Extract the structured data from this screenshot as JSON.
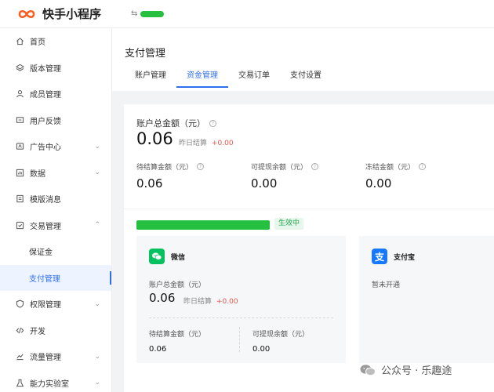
{
  "app": {
    "title": "快手小程序",
    "account_switch_icon": "⇆"
  },
  "sidebar": {
    "items": [
      {
        "label": "首页",
        "icon": "home-icon",
        "chevron": ""
      },
      {
        "label": "版本管理",
        "icon": "layers-icon",
        "chevron": ""
      },
      {
        "label": "成员管理",
        "icon": "user-icon",
        "chevron": ""
      },
      {
        "label": "用户反馈",
        "icon": "message-icon",
        "chevron": ""
      },
      {
        "label": "广告中心",
        "icon": "ad-icon",
        "chevron": "⌄"
      },
      {
        "label": "数据",
        "icon": "chart-icon",
        "chevron": "⌄"
      },
      {
        "label": "模版消息",
        "icon": "template-icon",
        "chevron": ""
      },
      {
        "label": "交易管理",
        "icon": "trade-icon",
        "chevron": "⌃"
      },
      {
        "label": "保证金",
        "sub": true
      },
      {
        "label": "支付管理",
        "sub": true,
        "active": true
      },
      {
        "label": "权限管理",
        "icon": "shield-icon",
        "chevron": "⌄"
      },
      {
        "label": "开发",
        "icon": "code-icon",
        "chevron": ""
      },
      {
        "label": "流量管理",
        "icon": "traffic-icon",
        "chevron": "⌄"
      },
      {
        "label": "能力实验室",
        "icon": "lab-icon",
        "chevron": "⌄"
      }
    ]
  },
  "page": {
    "title": "支付管理",
    "tabs": [
      "账户管理",
      "资金管理",
      "交易订单",
      "支付设置"
    ],
    "active_tab": 1
  },
  "summary": {
    "total_label": "账户总金额（元）",
    "total_amount": "0.06",
    "yesterday_label": "昨日结算",
    "yesterday_value": "+0.00",
    "pending_label": "待结算金额（元）",
    "pending_value": "0.06",
    "withdrawable_label": "可提现余额（元）",
    "withdrawable_value": "0.00",
    "frozen_label": "冻结金额（元）",
    "frozen_value": "0.00"
  },
  "account_status": "生效中",
  "wechat": {
    "name": "微信",
    "total_label": "账户总金额（元）",
    "total_amount": "0.06",
    "yesterday_label": "昨日结算",
    "yesterday_value": "+0.00",
    "pending_label": "待结算金额（元）",
    "pending_value": "0.06",
    "withdrawable_label": "可提现余额（元）",
    "withdrawable_value": "0.00"
  },
  "alipay": {
    "name": "支付宝",
    "status": "暂未开通"
  },
  "watermark": "公众号 · 乐趣途",
  "colors": {
    "accent": "#2f6fed",
    "positive_red": "#e2574c",
    "brand_orange": "#ff5b1f",
    "wechat_green": "#07c160",
    "alipay_blue": "#1677ff"
  }
}
